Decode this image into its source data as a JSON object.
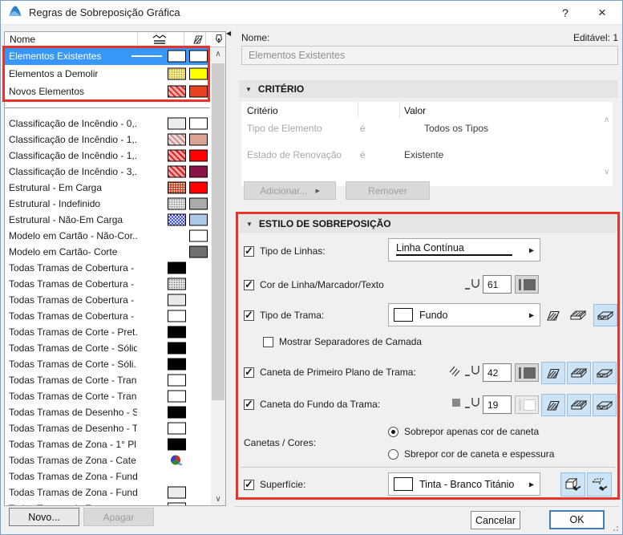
{
  "window": {
    "title": "Regras de Sobreposição Gráfica",
    "help": "?",
    "close": "×"
  },
  "colors": {
    "selection_blue": "#3797fb",
    "annotation_red": "#e8332a",
    "toggle_blue_bg": "#cde3f6",
    "toggle_blue_border": "#95c0e6",
    "ok_border_blue": "#3f7fbf"
  },
  "icons": {
    "titlebar_logo": "archicad-icon",
    "header_icons": [
      "linetype-icon",
      "fill-hatch-icon",
      "pen-color-icon"
    ],
    "collapse_triangle": "▼",
    "panel_collapse": "◀",
    "dropdown_arrow": "▶",
    "scroll_up": "∧",
    "scroll_down": "∨"
  },
  "list": {
    "header": {
      "name": "Nome"
    },
    "items": [
      {
        "label": "Elementos Existentes",
        "selected": true,
        "line": true,
        "fill": {
          "pattern": "solid",
          "bg": "#ffffff"
        },
        "pen": "#ffffff"
      },
      {
        "label": "Elementos a Demolir",
        "fill": {
          "pattern": "dots",
          "fg": "#c8a81e",
          "bg": "#f6f0a6"
        },
        "pen": "#ffff00"
      },
      {
        "label": "Novos Elementos",
        "fill": {
          "pattern": "hatch",
          "fg": "#d42a22",
          "bg": "#f4a9a9"
        },
        "pen": "#e8431f"
      },
      {
        "label": "Classificação de Incêndio - 0,...",
        "fill": {
          "pattern": "solid",
          "bg": "#ececec"
        },
        "pen": "#ffffff"
      },
      {
        "label": "Classificação de Incêndio - 1,...",
        "fill": {
          "pattern": "hatch",
          "fg": "#bd8d8d",
          "bg": "#eed9d9"
        },
        "pen": "#dba495"
      },
      {
        "label": "Classificação de Incêndio - 1,...",
        "fill": {
          "pattern": "hatch",
          "fg": "#d41a1a",
          "bg": "#f0a6a6"
        },
        "pen": "#fe0000"
      },
      {
        "label": "Classificação de Incêndio - 3,...",
        "fill": {
          "pattern": "hatch",
          "fg": "#d41a1a",
          "bg": "#f0a6a6"
        },
        "pen": "#8c1348"
      },
      {
        "label": "Estrutural - Em Carga",
        "fill": {
          "pattern": "dots",
          "fg": "#f4ece4",
          "bg": "#c53a18"
        },
        "pen": "#fe0000"
      },
      {
        "label": "Estrutural - Indefinido",
        "fill": {
          "pattern": "dots",
          "fg": "#999999",
          "bg": "#e8e8e8"
        },
        "pen": "#aaaaaa"
      },
      {
        "label": "Estrutural - Não-Em Carga",
        "fill": {
          "pattern": "check",
          "fg": "#2d39c6",
          "bg": "#eef2fb"
        },
        "pen": "#abc8e8"
      },
      {
        "label": "Modelo em Cartão - Não-Cor...",
        "fill": null,
        "pen": "#ffffff"
      },
      {
        "label": "Modelo em Cartão- Corte",
        "fill": null,
        "pen": "#707070"
      },
      {
        "label": "Todas Tramas de Cobertura - ...",
        "fill": {
          "pattern": "solid",
          "bg": "#000000"
        },
        "pen": null
      },
      {
        "label": "Todas Tramas de Cobertura - ...",
        "fill": {
          "pattern": "dots",
          "fg": "#8c8c8c",
          "bg": "#ededed"
        },
        "pen": null
      },
      {
        "label": "Todas Tramas de Cobertura - ...",
        "fill": {
          "pattern": "solid",
          "bg": "#e9e9e9"
        },
        "pen": null
      },
      {
        "label": "Todas Tramas de Cobertura - ...",
        "fill": {
          "pattern": "solid",
          "bg": "#ffffff"
        },
        "pen": null
      },
      {
        "label": "Todas Tramas de Corte - Pret...",
        "fill": {
          "pattern": "solid",
          "bg": "#000000"
        },
        "pen": null
      },
      {
        "label": "Todas Tramas de Corte - Sólido",
        "fill": {
          "pattern": "solid",
          "bg": "#000000"
        },
        "pen": null
      },
      {
        "label": "Todas Tramas de Corte - Sóli...",
        "fill": {
          "pattern": "solid",
          "bg": "#000000"
        },
        "pen": null
      },
      {
        "label": "Todas Tramas de Corte - Tran...",
        "fill": {
          "pattern": "solid",
          "bg": "#ffffff"
        },
        "pen": null
      },
      {
        "label": "Todas Tramas de Corte - Tran...",
        "fill": {
          "pattern": "solid",
          "bg": "#ffffff"
        },
        "pen": null
      },
      {
        "label": "Todas Tramas de Desenho - S...",
        "fill": {
          "pattern": "solid",
          "bg": "#000000"
        },
        "pen": null
      },
      {
        "label": "Todas Tramas de Desenho - T...",
        "fill": {
          "pattern": "solid",
          "bg": "#ffffff"
        },
        "pen": null
      },
      {
        "label": "Todas Tramas de Zona - 1° Pl...",
        "fill": {
          "pattern": "solid",
          "bg": "#000000"
        },
        "pen": null
      },
      {
        "label": "Todas Tramas de Zona - Cate...",
        "fill": {
          "pattern": "pie"
        },
        "pen": null
      },
      {
        "label": "Todas Tramas de Zona - Fund...",
        "fill": null,
        "pen": null
      },
      {
        "label": "Todas Tramas de Zona - Fund...",
        "fill": {
          "pattern": "solid",
          "bg": "#ececec"
        },
        "pen": null
      },
      {
        "label": "Todas Tramas de Zona - ...",
        "fill": {
          "pattern": "solid",
          "bg": "#ffffff"
        },
        "pen": null
      }
    ],
    "buttons": {
      "new": "Novo...",
      "delete": "Apagar"
    }
  },
  "detail": {
    "name_label": "Nome:",
    "editable": "Editável: 1",
    "name_value": "Elementos Existentes",
    "criteria": {
      "title": "CRITÉRIO",
      "col_criterion": "Critério",
      "col_value": "Valor",
      "rows": [
        {
          "criterion": "Tipo de Elemento",
          "op": "é",
          "value": "Todos os Tipos",
          "value_indent": 228
        },
        {
          "criterion": "Estado de Renovação",
          "op": "é",
          "value": "Existente",
          "value_indent": 203
        }
      ],
      "add_label": "Adicionar...",
      "add_arrow": "▶",
      "remove_label": "Remover"
    },
    "style": {
      "title": "ESTILO DE SOBREPOSIÇÃO",
      "line_type": {
        "label": "Tipo de Linhas:",
        "value": "Linha Contínua",
        "checked": true
      },
      "line_color": {
        "label": "Cor de Linha/Marcador/Texto",
        "pen": "61",
        "checked": true
      },
      "fill_type": {
        "label": "Tipo de Trama:",
        "value": "Fundo",
        "checked": true
      },
      "layer_separators": {
        "label": "Mostrar Separadores de Camada",
        "checked": false
      },
      "fg_pen": {
        "label": "Caneta de Primeiro Plano de Trama:",
        "pen": "42",
        "checked": true
      },
      "bg_pen": {
        "label": "Caneta do Fundo da Trama:",
        "pen": "19",
        "checked": true
      },
      "pens_colors": {
        "label": "Canetas / Cores:",
        "options": [
          "Sobrepor apenas cor de caneta",
          "Sbrepor cor de caneta e espessura"
        ],
        "selected": 0
      },
      "surface": {
        "label": "Superfície:",
        "value": "Tinta - Branco Titánio",
        "checked": true
      }
    },
    "cancel": "Cancelar",
    "ok": "OK"
  }
}
